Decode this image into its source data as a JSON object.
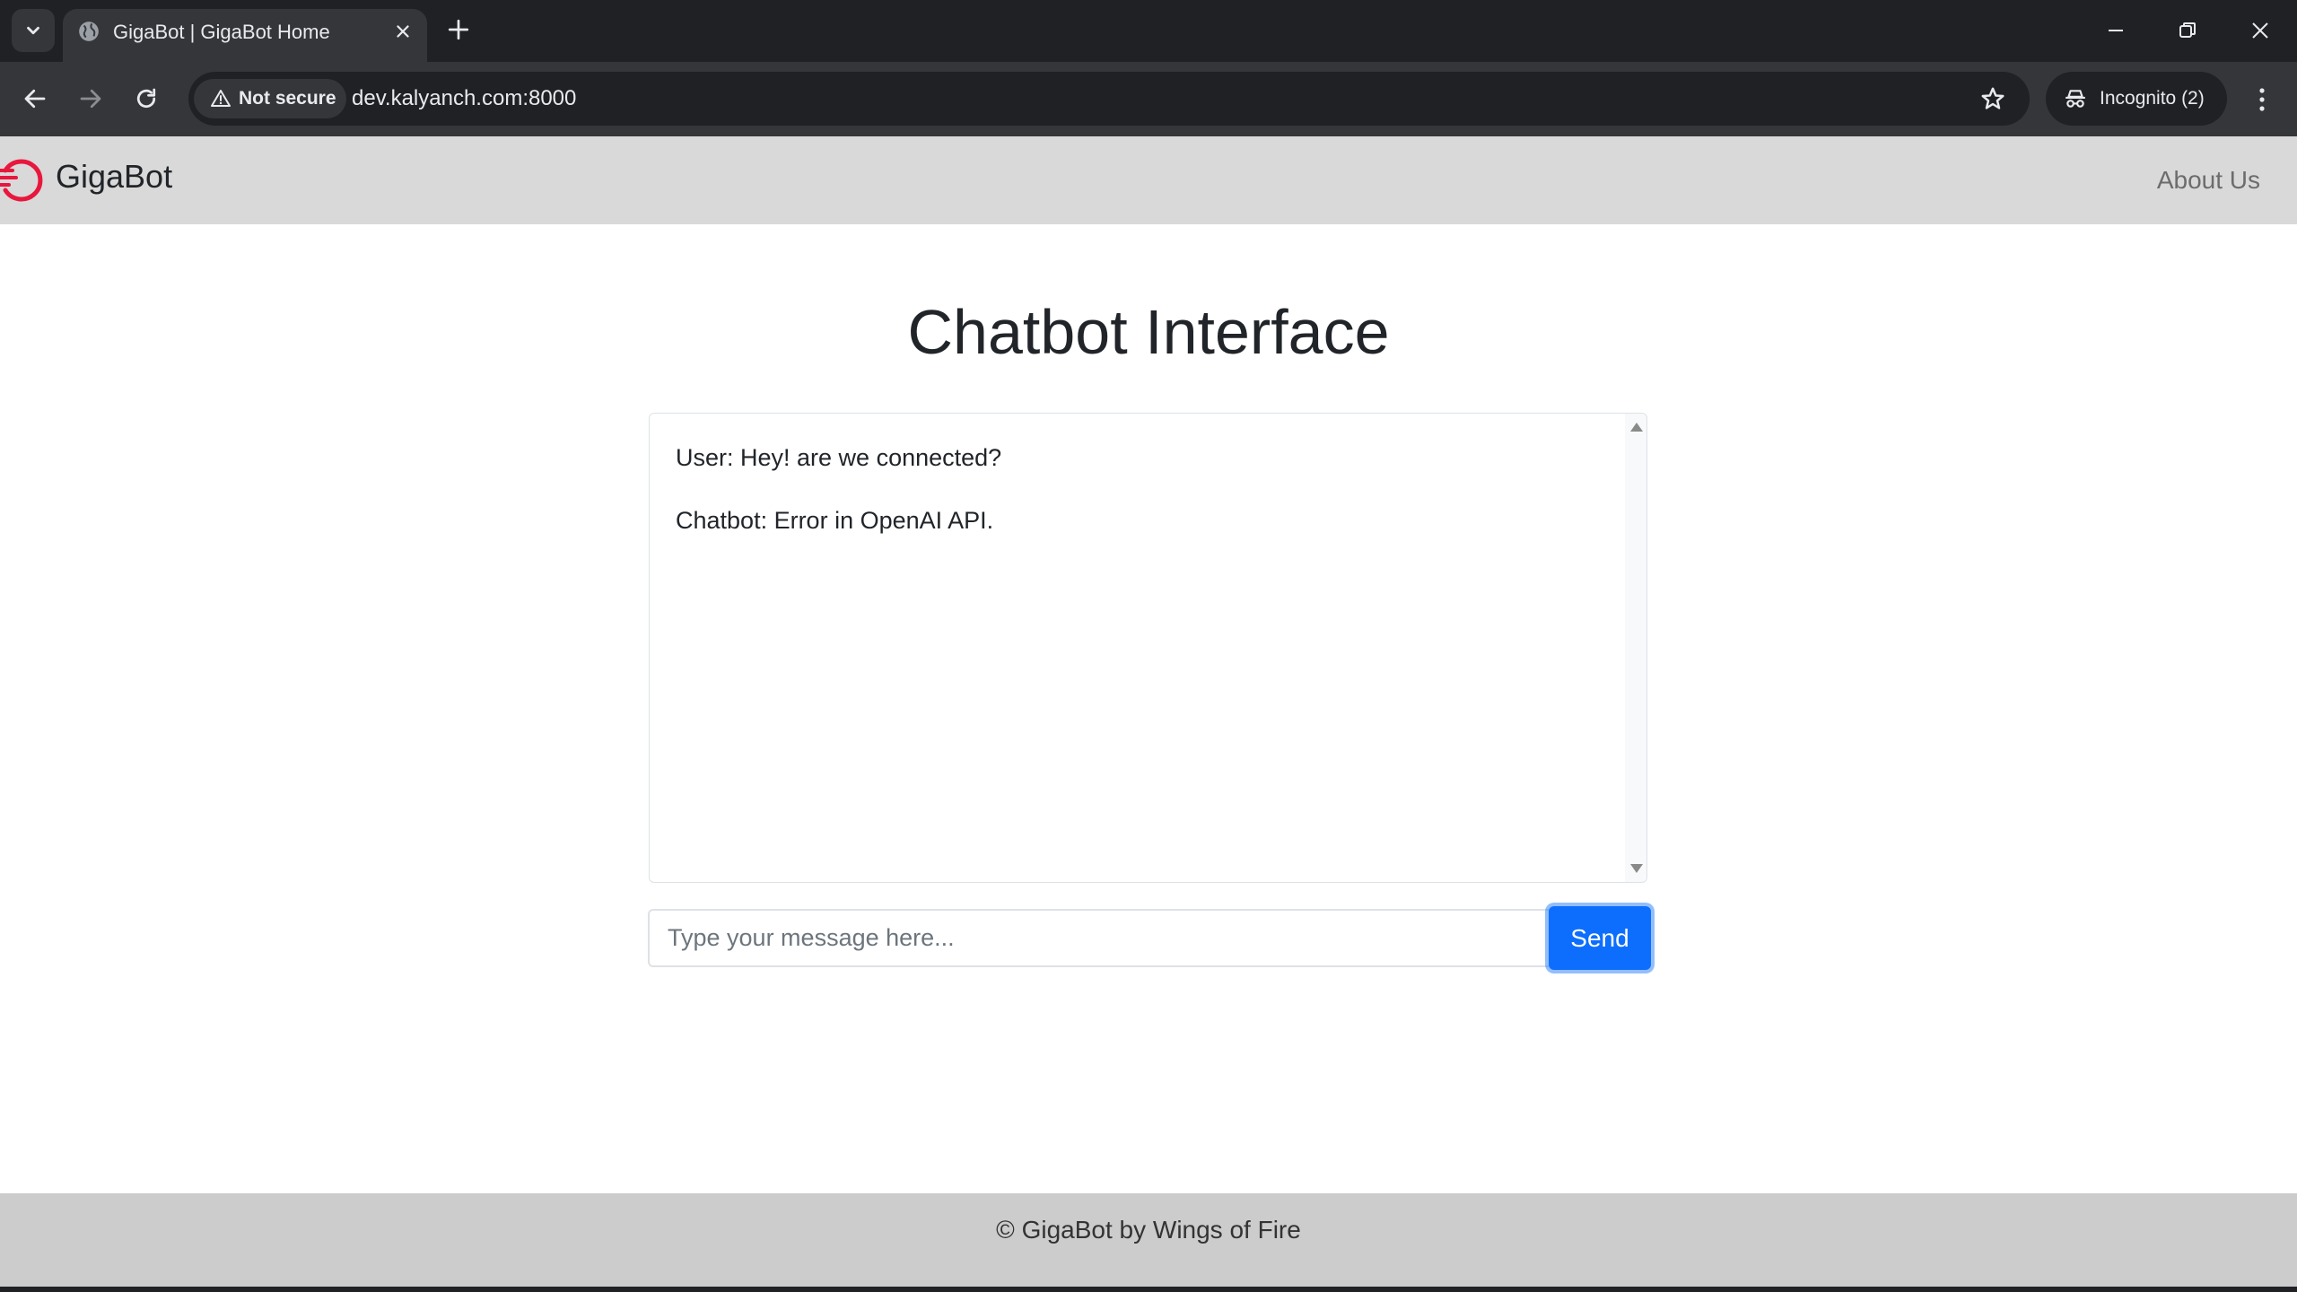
{
  "browser": {
    "tab_title": "GigaBot | GigaBot Home",
    "security_label": "Not secure",
    "url": "dev.kalyanch.com:8000",
    "incognito_label": "Incognito (2)"
  },
  "navbar": {
    "brand": "GigaBot",
    "about_link": "About Us"
  },
  "main": {
    "title": "Chatbot Interface",
    "messages": [
      "User: Hey! are we connected?",
      "Chatbot: Error in OpenAI API."
    ],
    "input_placeholder": "Type your message here...",
    "send_label": "Send"
  },
  "footer": {
    "text": "© GigaBot by Wings of Fire"
  },
  "colors": {
    "brand_red": "#e8173c",
    "primary_blue": "#0d6efd",
    "navbar_bg": "#d9d9d9",
    "footer_bg": "#cccccc"
  },
  "icons": {
    "tab_search": "chevron-down-icon",
    "favicon": "globe-icon",
    "close_tab": "close-icon",
    "new_tab": "plus-icon",
    "minimize": "minimize-icon",
    "restore": "restore-icon",
    "close_window": "close-icon",
    "back": "arrow-left-icon",
    "forward": "arrow-right-icon",
    "reload": "reload-icon",
    "warning": "warning-icon",
    "bookmark": "star-icon",
    "incognito": "incognito-icon",
    "menu": "kebab-menu-icon",
    "brand_logo": "gigabot-logo"
  }
}
